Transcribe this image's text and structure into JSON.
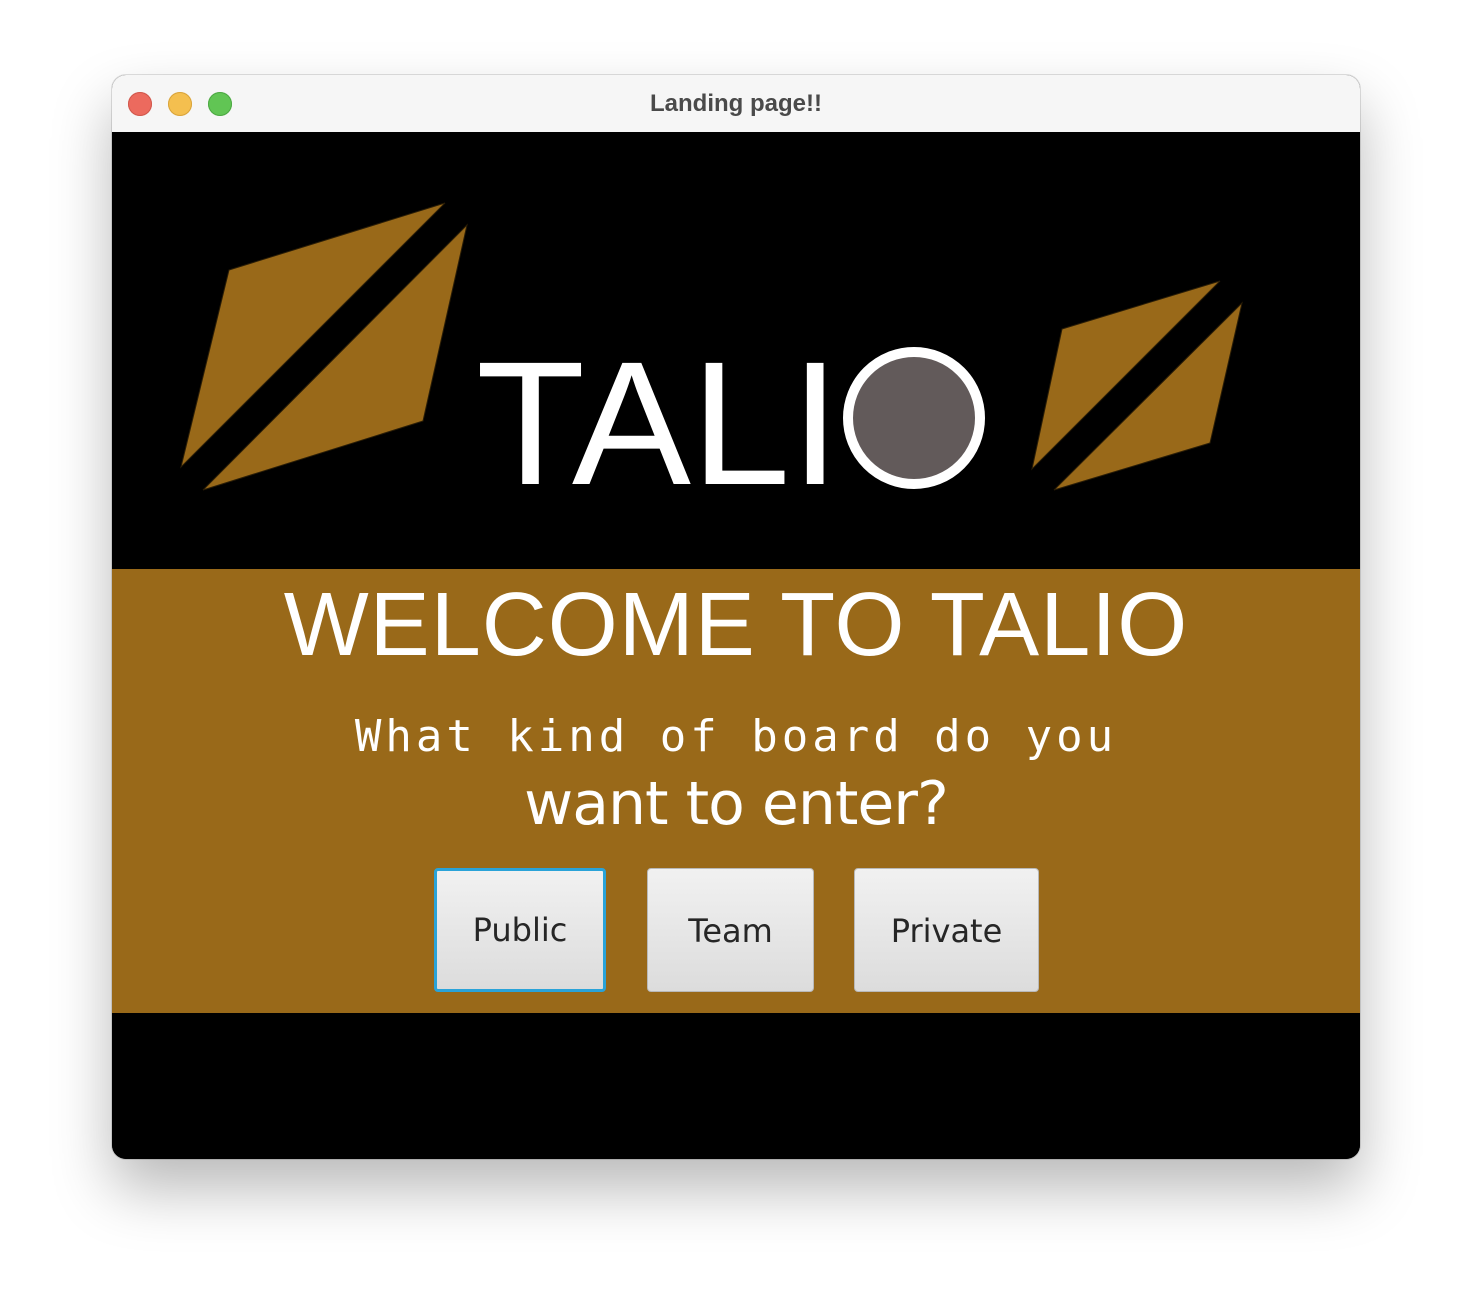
{
  "window": {
    "title": "Landing page!!",
    "controls": {
      "close": "close",
      "minimize": "minimize",
      "maximize": "maximize"
    }
  },
  "logo": {
    "text": "TALIO",
    "colors": {
      "accent": "#996919",
      "text": "#ffffff",
      "circle_fill": "#625a5a"
    }
  },
  "main": {
    "welcome": "WELCOME TO TALIO",
    "question_line1": "What kind of board do you",
    "question_line2": "want to enter?",
    "buttons": [
      {
        "label": "Public",
        "focused": true
      },
      {
        "label": "Team",
        "focused": false
      },
      {
        "label": "Private",
        "focused": false
      }
    ]
  },
  "colors": {
    "background": "#000000",
    "band": "#996919",
    "focus_ring": "#2aa3d8"
  }
}
